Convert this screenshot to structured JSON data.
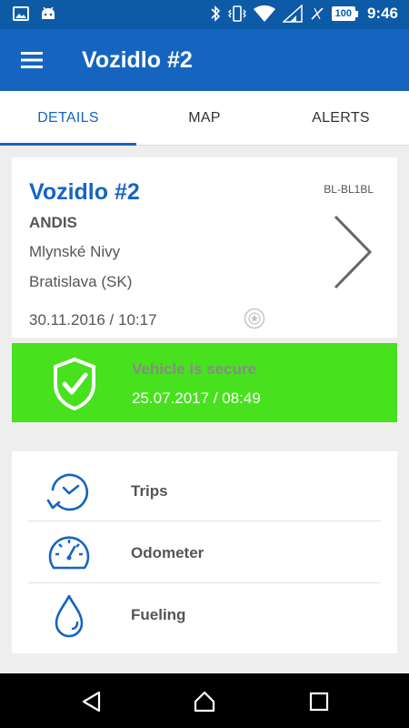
{
  "status_bar": {
    "time": "9:46",
    "battery": "100",
    "icons": [
      "image-icon",
      "android-icon",
      "bluetooth-icon",
      "vibrate-icon",
      "wifi-icon",
      "signal-icon",
      "battery-icon"
    ]
  },
  "app_bar": {
    "title": "Vozidlo #2",
    "menu_icon": "hamburger-menu-icon"
  },
  "tabs": [
    {
      "label": "DETAILS",
      "active": true
    },
    {
      "label": "MAP",
      "active": false
    },
    {
      "label": "ALERTS",
      "active": false
    }
  ],
  "vehicle": {
    "name": "Vozidlo #2",
    "plate": "BL-BL1BL",
    "owner": "ANDIS",
    "street": "Mlynské Nivy",
    "city": "Bratislava (SK)",
    "datetime": "30.11.2016 / 10:17"
  },
  "security": {
    "status": "Vehicle is secure",
    "time": "25.07.2017 / 08:49",
    "color": "#48e11e"
  },
  "menu": [
    {
      "label": "Trips",
      "icon": "clock-arrow-icon"
    },
    {
      "label": "Odometer",
      "icon": "speedometer-icon"
    },
    {
      "label": "Fueling",
      "icon": "droplet-icon"
    }
  ],
  "colors": {
    "primary": "#1565c0",
    "status_bar": "#0d5aa7",
    "secure": "#48e11e"
  }
}
